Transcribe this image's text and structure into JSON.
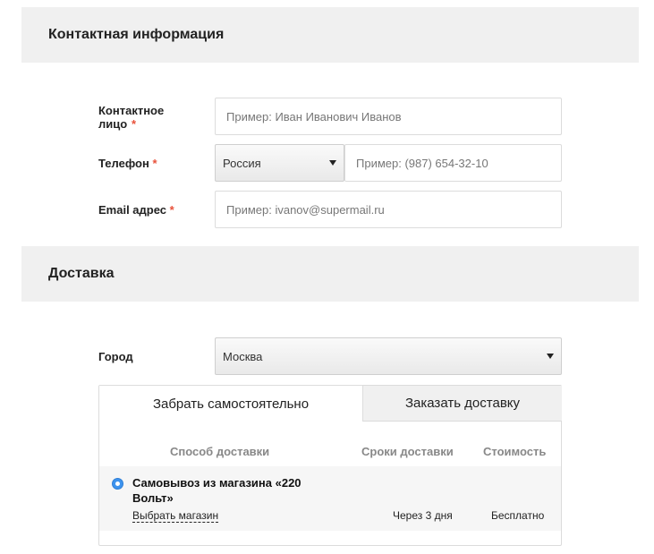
{
  "contact": {
    "title": "Контактная информация",
    "person_label": "Контактное лицо",
    "person_placeholder": "Пример: Иван Иванович Иванов",
    "phone_label": "Телефон",
    "country_selected": "Россия",
    "phone_placeholder": "Пример: (987) 654-32-10",
    "email_label": "Email адрес",
    "email_placeholder": "Пример: ivanov@supermail.ru",
    "required_mark": "*"
  },
  "delivery": {
    "title": "Доставка",
    "city_label": "Город",
    "city_selected": "Москва",
    "tabs": [
      {
        "label": "Забрать самостоятельно",
        "active": true
      },
      {
        "label": "Заказать доставку",
        "active": false
      }
    ],
    "columns": {
      "method": "Способ доставки",
      "term": "Сроки доставки",
      "price": "Стоимость"
    },
    "options": [
      {
        "name": "Самовывоз из магазина «220 Вольт»",
        "link": "Выбрать магазин",
        "term": "Через 3 дня",
        "price": "Бесплатно",
        "selected": true
      }
    ]
  }
}
